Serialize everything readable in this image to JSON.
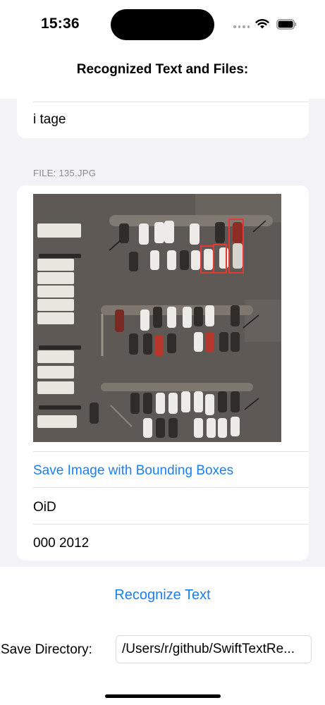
{
  "status_bar": {
    "time": "15:36",
    "signal_icon": "cellular-dots-icon",
    "wifi_icon": "wifi-icon",
    "battery_icon": "battery-icon"
  },
  "nav": {
    "title": "Recognized Text and Files:"
  },
  "list": {
    "top_card": {
      "text": "i tage"
    },
    "file_section": {
      "header": "FILE: 135.JPG",
      "image_description": "aerial parking lot photo with red bounding boxes",
      "save_link": "Save Image with Bounding Boxes",
      "rows": [
        "OiD",
        "000 2012"
      ]
    }
  },
  "actions": {
    "recognize_label": "Recognize Text"
  },
  "save_directory": {
    "label": "Save Directory:",
    "value": "/Users/r/github/SwiftTextRe..."
  },
  "colors": {
    "accent": "#1a7ff0",
    "bounding_box": "#e53935",
    "grouped_background": "#f2f2f7"
  }
}
